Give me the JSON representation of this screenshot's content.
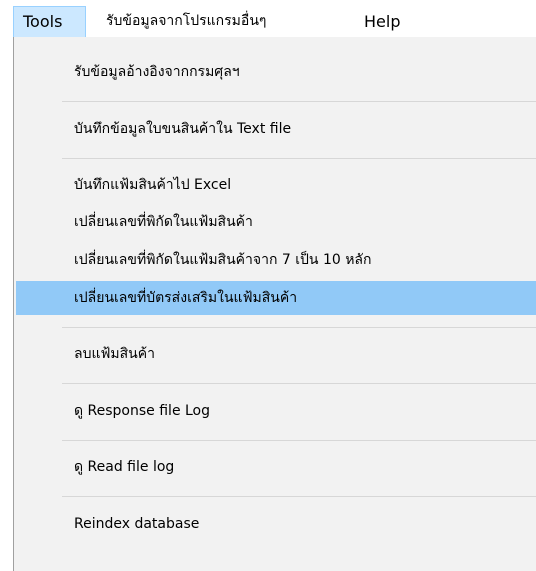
{
  "menubar": {
    "tools": "Tools",
    "import_other": "รับข้อมูลจากโปรแกรมอื่นๆ",
    "help": "Help"
  },
  "tools_menu": {
    "items": [
      "รับข้อมูลอ้างอิงจากกรมศุลฯ",
      "บันทึกข้อมูลใบขนสินค้าใน Text file",
      "บันทึกแฟ้มสินค้าไป Excel",
      "เปลี่ยนเลขที่พิกัดในแฟ้มสินค้า",
      "เปลี่ยนเลขที่พิกัดในแฟ้มสินค้าจาก 7 เป็น 10 หลัก",
      "เปลี่ยนเลขที่บัตรส่งเสริมในแฟ้มสินค้า",
      "ลบแฟ้มสินค้า",
      "ดู Response file Log",
      "ดู Read file log",
      "Reindex database"
    ],
    "highlighted_index": 5
  }
}
